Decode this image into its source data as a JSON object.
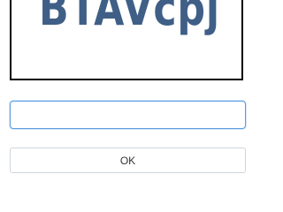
{
  "captcha": {
    "text": "BTAVcpj",
    "text_color": "#3f5f86"
  },
  "answer": {
    "value": "",
    "placeholder": ""
  },
  "ok_label": "OK",
  "colors": {
    "input_focus_border": "#5b9de0",
    "captcha_border": "#000000"
  }
}
